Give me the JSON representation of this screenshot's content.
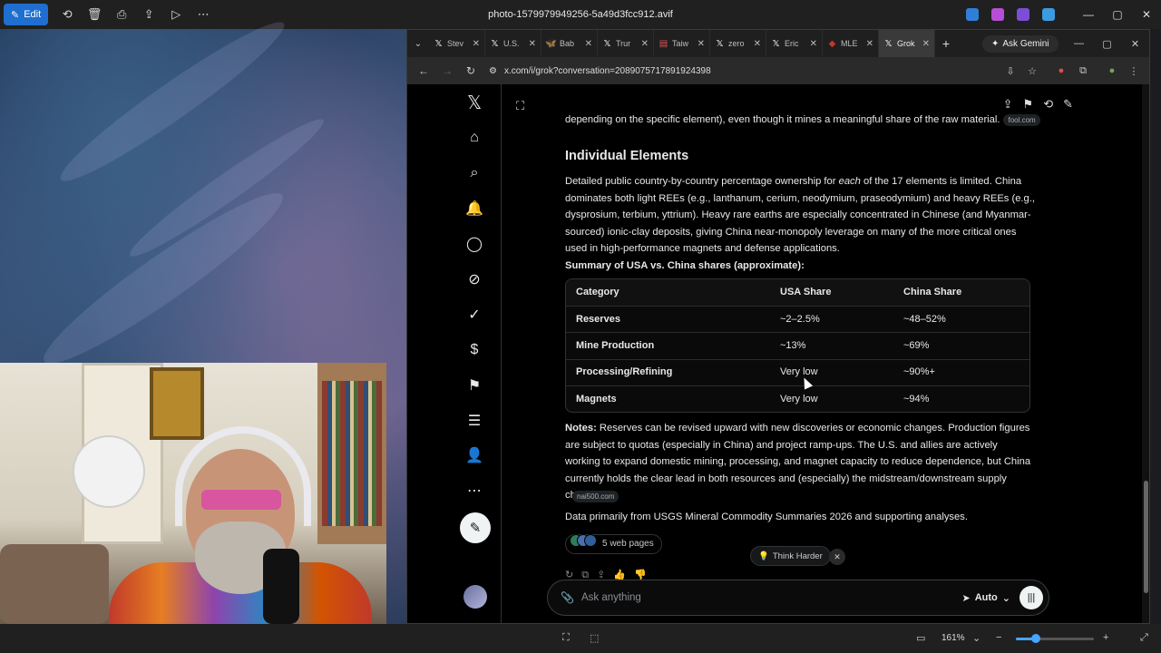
{
  "viewer": {
    "edit_label": "Edit",
    "file_title": "photo-1579979949256-5a49d3fcc912.avif",
    "zoom_label": "161%",
    "zoom_level": 0.25
  },
  "browser": {
    "tabs": [
      {
        "label": "Stev",
        "icon": "x-icon"
      },
      {
        "label": "U.S.",
        "icon": "x-icon"
      },
      {
        "label": "Bab",
        "icon": "bluesky-icon"
      },
      {
        "label": "Trur",
        "icon": "x-icon"
      },
      {
        "label": "Taiw",
        "icon": "news-icon"
      },
      {
        "label": "zero",
        "icon": "x-icon"
      },
      {
        "label": "Eric",
        "icon": "x-icon"
      },
      {
        "label": "MLE",
        "icon": "site-icon"
      },
      {
        "label": "Grok",
        "icon": "x-icon",
        "active": true
      }
    ],
    "gemini_label": "Ask Gemini",
    "url": "x.com/i/grok?conversation=2089075717891924398"
  },
  "grok": {
    "prev_line": "depending on the specific element), even though it mines a meaningful share of the raw material.",
    "prev_source": "fool.com",
    "section_title": "Individual Elements",
    "para1_a": "Detailed public country-by-country percentage ownership for ",
    "para1_em": "each",
    "para1_b": " of the 17 elements is limited. China dominates both light REEs (e.g., lanthanum, cerium, neodymium, praseodymium) and heavy REEs (e.g., dysprosium, terbium, yttrium). Heavy rare earths are especially concentrated in Chinese (and Myanmar-sourced) ionic-clay deposits, giving China near-monopoly leverage on many of the more critical ones used in high-performance magnets and defense applications.",
    "summary_heading": "Summary of USA vs. China shares (approximate):",
    "table": {
      "headers": [
        "Category",
        "USA Share",
        "China Share"
      ],
      "rows": [
        [
          "Reserves",
          "~2–2.5%",
          "~48–52%"
        ],
        [
          "Mine Production",
          "~13%",
          "~69%"
        ],
        [
          "Processing/Refining",
          "Very low",
          "~90%+"
        ],
        [
          "Magnets",
          "Very low",
          "~94%"
        ]
      ]
    },
    "notes_label": "Notes:",
    "notes_text": " Reserves can be revised upward with new discoveries or economic changes. Production figures are subject to quotas (especially in China) and project ramp-ups. The U.S. and allies are actively working to expand domestic mining, processing, and magnet capacity to reduce dependence, but China currently holds the clear lead in both resources and (especially) the midstream/downstream supply chain.",
    "notes_source": "nai500.com",
    "data_from": "Data primarily from USGS Mineral Commodity Summaries 2026 and supporting analyses.",
    "web_pages": "5 web pages",
    "think_harder": "Think Harder",
    "ask_placeholder": "Ask anything",
    "mode": "Auto"
  }
}
